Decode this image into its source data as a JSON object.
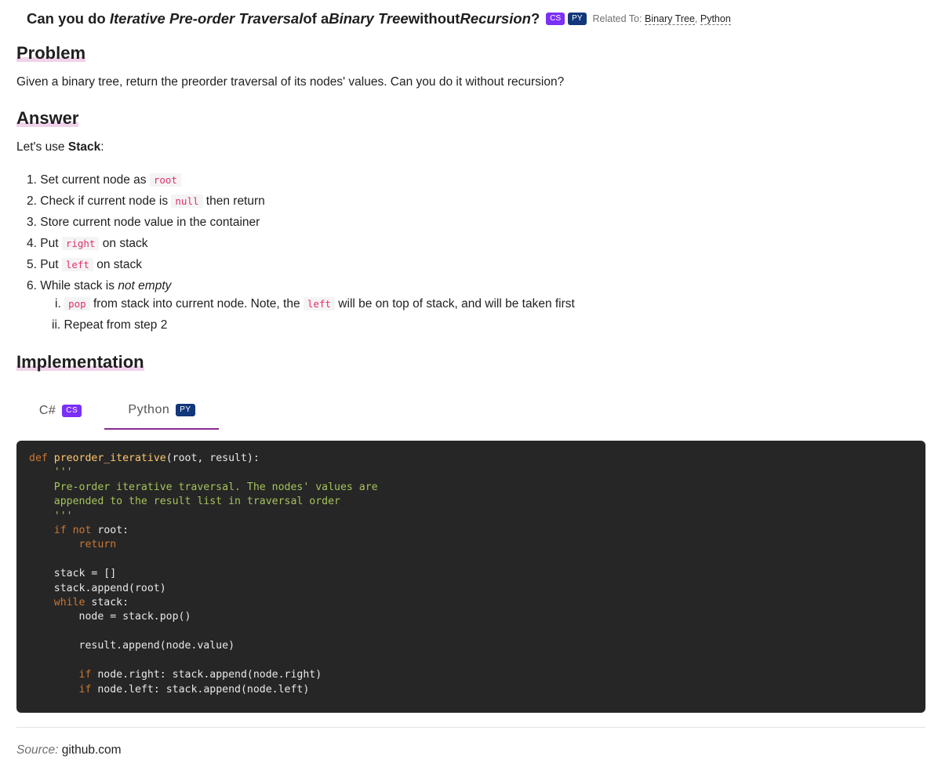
{
  "title": {
    "p1": "Can you do ",
    "p2": "Iterative Pre-order Traversal",
    "p3": " of a ",
    "p4": "Binary Tree",
    "p5": " without ",
    "p6": "Recursion",
    "p7": "?",
    "badge_cs": "CS",
    "badge_py": "PY",
    "related_label": "Related To: ",
    "related_links": [
      "Binary Tree",
      "Python"
    ],
    "related_sep": ", "
  },
  "problem": {
    "heading": "Problem",
    "text": "Given a binary tree, return the preorder traversal of its nodes' values. Can you do it without recursion?"
  },
  "answer": {
    "heading": "Answer",
    "intro_pre": "Let's use ",
    "intro_bold": "Stack",
    "intro_post": ":",
    "steps": [
      {
        "num": "1.",
        "pre": "Set current node as ",
        "code": "root",
        "post": ""
      },
      {
        "num": "2.",
        "pre": "Check if current node is ",
        "code": "null",
        "post": " then return"
      },
      {
        "num": "3.",
        "pre": "Store current node value in the container",
        "code": "",
        "post": ""
      },
      {
        "num": "4.",
        "pre": "Put ",
        "code": "right",
        "post": " on stack"
      },
      {
        "num": "5.",
        "pre": "Put ",
        "code": "left",
        "post": " on stack"
      },
      {
        "num": "6.",
        "pre": "While stack is ",
        "em": "not empty"
      }
    ],
    "substeps": [
      {
        "num": "i.",
        "code1": "pop",
        "mid": " from stack into current node. Note, the ",
        "code2": "left",
        "post": " will be on top of stack, and will be taken first"
      },
      {
        "num": "ii.",
        "text": "Repeat from step 2"
      }
    ]
  },
  "implementation": {
    "heading": "Implementation",
    "tabs": [
      {
        "label": "C#",
        "badge": "CS",
        "active": false
      },
      {
        "label": "Python",
        "badge": "PY",
        "active": true
      }
    ],
    "code_lines": [
      "def preorder_iterative(root, result):",
      "    '''",
      "    Pre-order iterative traversal. The nodes' values are",
      "    appended to the result list in traversal order",
      "    '''",
      "    if not root:",
      "        return",
      "",
      "    stack = []",
      "    stack.append(root)",
      "    while stack:",
      "        node = stack.pop()",
      "",
      "        result.append(node.value)",
      "",
      "        if node.right: stack.append(node.right)",
      "        if node.left: stack.append(node.left)"
    ]
  },
  "source": {
    "label": "Source:",
    "link": "github.com"
  },
  "colors": {
    "badge_cs": "#7b2ff7",
    "badge_py": "#12377a",
    "inline_code": "#e0306a",
    "code_bg": "#262626",
    "keyword": "#cc7832",
    "function": "#ffc66d",
    "string": "#a5c25c",
    "tab_active_underline": "#8a2b8f"
  }
}
